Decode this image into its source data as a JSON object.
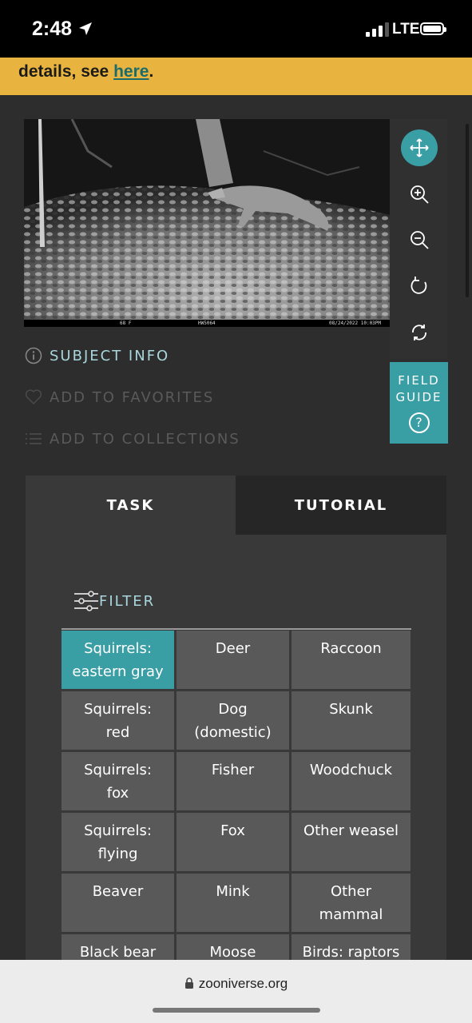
{
  "status_bar": {
    "time": "2:48",
    "network": "LTE"
  },
  "banner": {
    "prefix": "details, see ",
    "link": "here",
    "suffix": "."
  },
  "photo": {
    "stamp_temp": "68 F",
    "stamp_camera": "HW5064",
    "stamp_datetime": "08/24/2022 10:03PM"
  },
  "toolbar": {
    "tools": [
      "move-icon",
      "zoom-in-icon",
      "zoom-out-icon",
      "rotate-icon",
      "reset-icon"
    ],
    "field_guide_line1": "FIELD",
    "field_guide_line2": "GUIDE",
    "field_guide_q": "?"
  },
  "meta": {
    "subject_info": "SUBJECT INFO",
    "add_favorites": "ADD TO FAVORITES",
    "add_collections": "ADD TO COLLECTIONS"
  },
  "tabs": {
    "task": "TASK",
    "tutorial": "TUTORIAL"
  },
  "filter_label": "FILTER",
  "choices": [
    [
      "Squirrels:",
      "eastern gray"
    ],
    [
      "Deer"
    ],
    [
      "Raccoon"
    ],
    [
      "Squirrels:",
      "red"
    ],
    [
      "Dog",
      "(domestic)"
    ],
    [
      "Skunk"
    ],
    [
      "Squirrels:",
      "fox"
    ],
    [
      "Fisher"
    ],
    [
      "Woodchuck"
    ],
    [
      "Squirrels:",
      "flying"
    ],
    [
      "Fox"
    ],
    [
      "Other weasel"
    ],
    [
      "Beaver"
    ],
    [
      "Mink"
    ],
    [
      "Other",
      "mammal"
    ],
    [
      "Black bear"
    ],
    [
      "Moose"
    ],
    [
      "Birds: raptors"
    ]
  ],
  "selected_choice": 0,
  "colors": {
    "accent": "#3a9ea5",
    "banner": "#e8b43f"
  },
  "url": "zooniverse.org"
}
